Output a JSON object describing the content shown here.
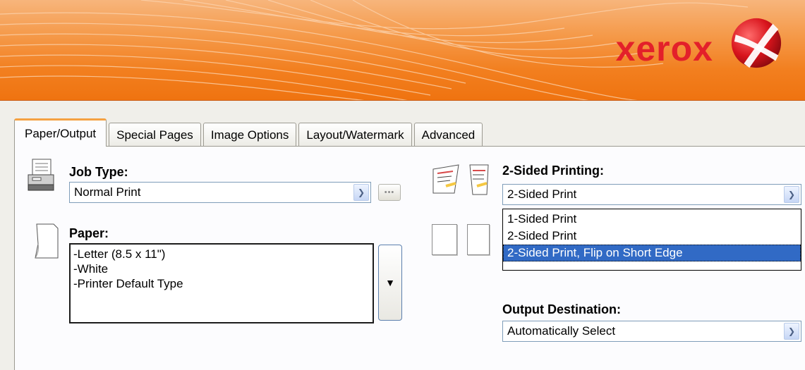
{
  "brand": {
    "name": "xerox",
    "colors": {
      "banner": "#f27f1f",
      "logo_red": "#e3202a",
      "highlight": "#316ac5",
      "tab_accent": "#f5a142"
    }
  },
  "tabs": [
    {
      "label": "Paper/Output",
      "active": true
    },
    {
      "label": "Special Pages",
      "active": false
    },
    {
      "label": "Image Options",
      "active": false
    },
    {
      "label": "Layout/Watermark",
      "active": false
    },
    {
      "label": "Advanced",
      "active": false
    }
  ],
  "job_type": {
    "label": "Job Type:",
    "value": "Normal Print",
    "more_button_label": "•••",
    "icon": "printer-icon"
  },
  "paper": {
    "label": "Paper:",
    "lines": [
      "-Letter (8.5 x 11\")",
      "-White",
      "-Printer Default Type"
    ],
    "icon": "paper-sheet-icon"
  },
  "two_sided": {
    "label": "2-Sided Printing:",
    "value": "2-Sided Print",
    "options": [
      "1-Sided Print",
      "2-Sided Print",
      "2-Sided Print, Flip on Short Edge"
    ],
    "selected_option": "2-Sided Print, Flip on Short Edge",
    "icon": "duplex-pages-icon"
  },
  "output_destination": {
    "label": "Output Destination:",
    "value": "Automatically Select"
  }
}
